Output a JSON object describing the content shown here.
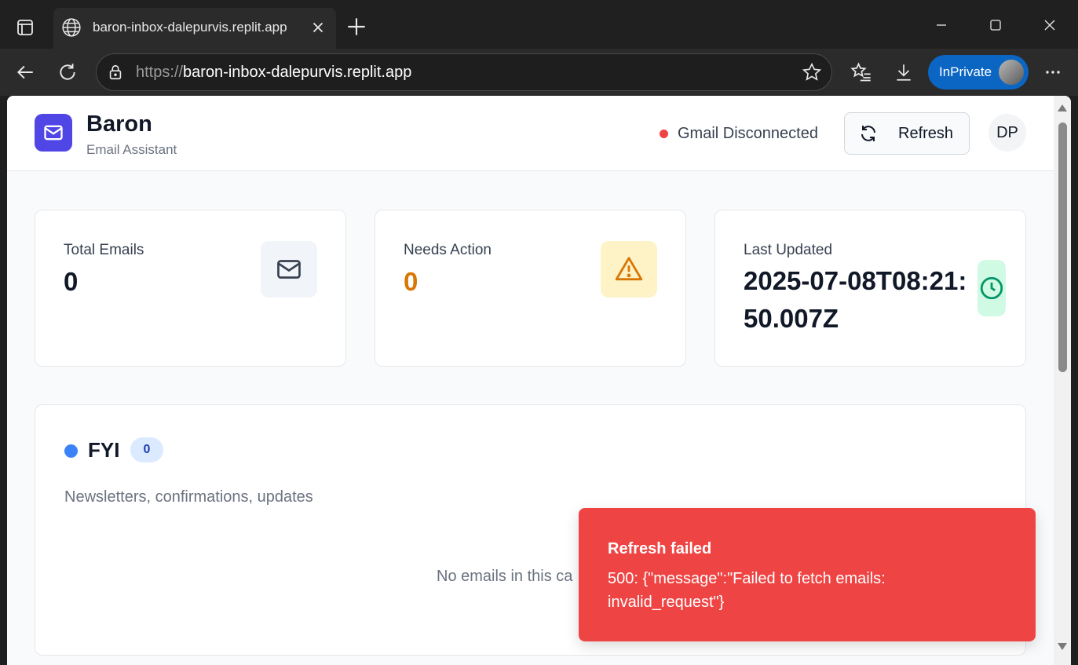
{
  "browser": {
    "tab_title": "baron-inbox-dalepurvis.replit.app",
    "url_protocol": "https://",
    "url_host": "baron-inbox-dalepurvis.replit.app",
    "inprivate_label": "InPrivate"
  },
  "app": {
    "title": "Baron",
    "subtitle": "Email Assistant",
    "status_text": "Gmail Disconnected",
    "status_color": "#ef4444",
    "refresh_label": "Refresh",
    "user_initials": "DP"
  },
  "stats": [
    {
      "label": "Total Emails",
      "value": "0",
      "icon": "mail-icon"
    },
    {
      "label": "Needs Action",
      "value": "0",
      "icon": "warning-icon"
    },
    {
      "label": "Last Updated",
      "value": "2025-07-08T08:21:50.007Z",
      "icon": "clock-icon"
    }
  ],
  "section": {
    "title": "FYI",
    "count": "0",
    "description": "Newsletters, confirmations, updates",
    "empty_text": "No emails in this ca"
  },
  "toast": {
    "title": "Refresh failed",
    "message": "500: {\"message\":\"Failed to fetch emails: invalid_request\"}"
  },
  "colors": {
    "brand": "#4f46e5",
    "warning": "#d97706",
    "toast_bg": "#ef4444",
    "fyi_dot": "#3b82f6"
  }
}
